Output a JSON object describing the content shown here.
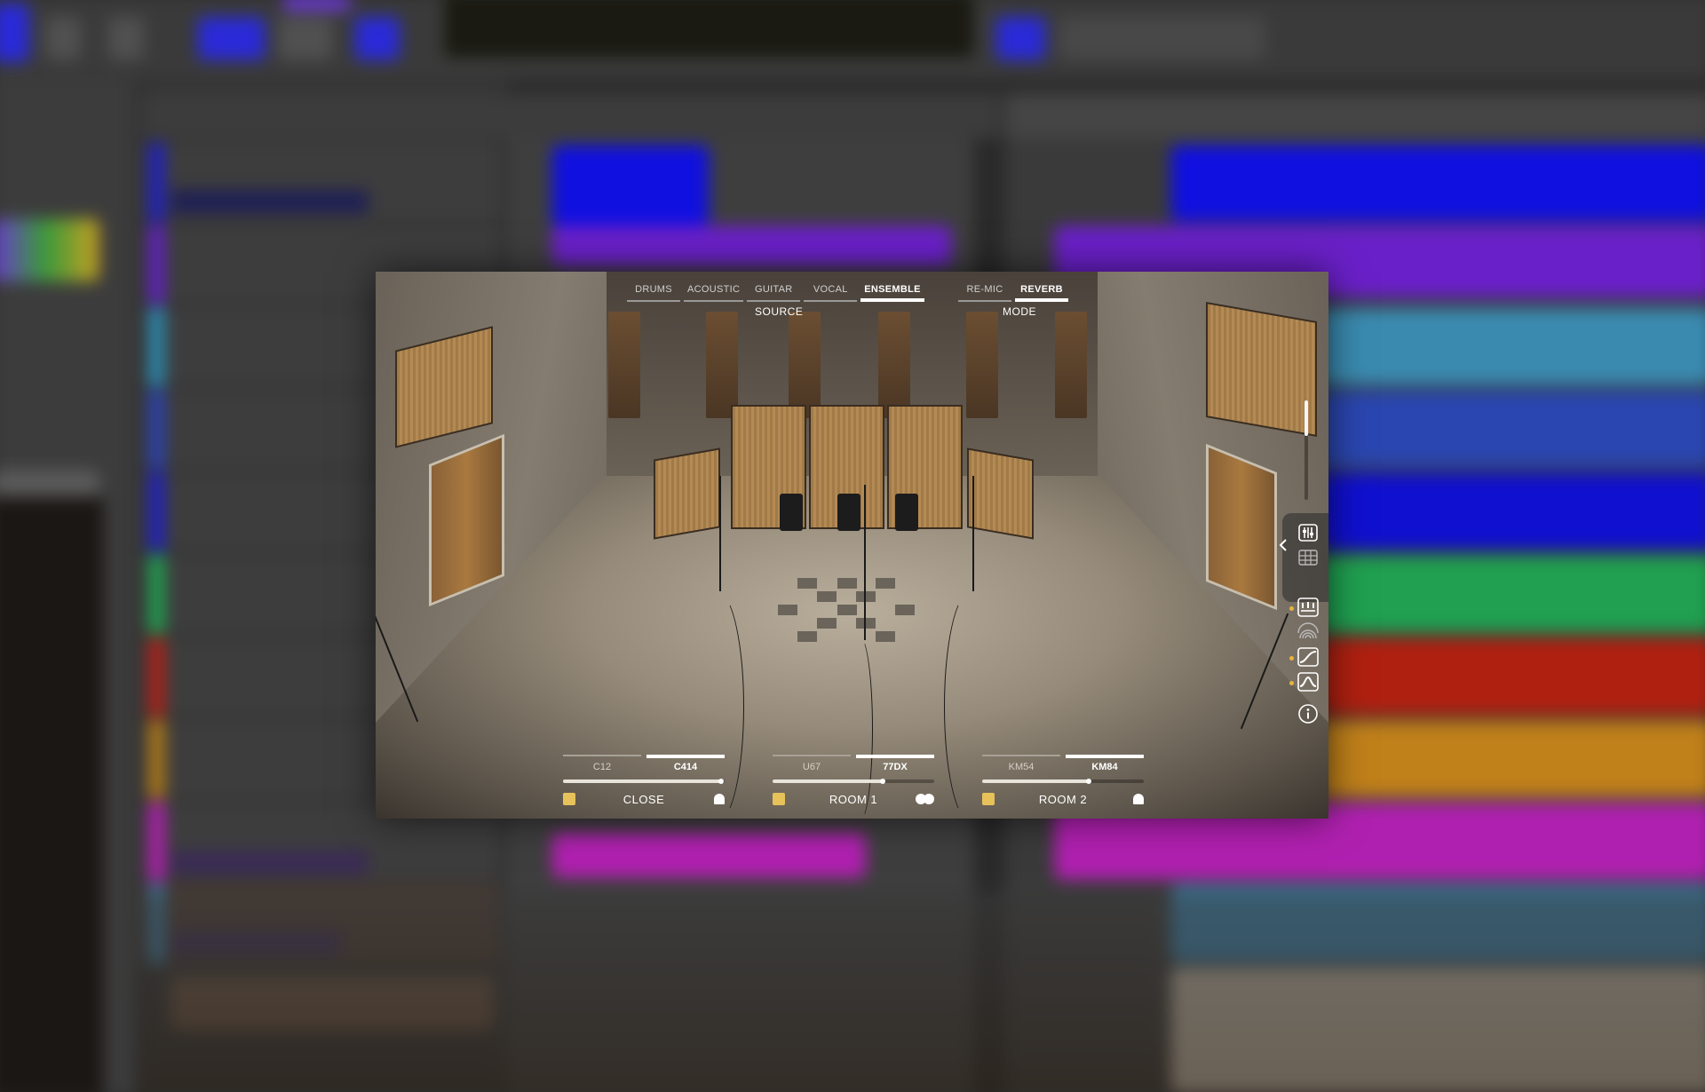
{
  "plugin": {
    "source": {
      "caption": "SOURCE",
      "tabs": [
        {
          "label": "DRUMS",
          "active": false
        },
        {
          "label": "ACOUSTIC",
          "active": false
        },
        {
          "label": "GUITAR",
          "active": false
        },
        {
          "label": "VOCAL",
          "active": false
        },
        {
          "label": "ENSEMBLE",
          "active": true
        }
      ]
    },
    "mode": {
      "caption": "MODE",
      "tabs": [
        {
          "label": "RE-MIC",
          "active": false
        },
        {
          "label": "REVERB",
          "active": true
        }
      ]
    },
    "mics": [
      {
        "name": "CLOSE",
        "options": [
          "C12",
          "C414"
        ],
        "selected": "C414",
        "level": 0.98,
        "enabled": true,
        "pattern": "half"
      },
      {
        "name": "ROOM 1",
        "options": [
          "U67",
          "77DX"
        ],
        "selected": "77DX",
        "level": 0.68,
        "enabled": true,
        "pattern": "double"
      },
      {
        "name": "ROOM 2",
        "options": [
          "KM54",
          "KM84"
        ],
        "selected": "KM84",
        "level": 0.66,
        "enabled": true,
        "pattern": "half"
      }
    ],
    "output_level": 0.35,
    "side_icons": [
      "chevron-left-icon",
      "mixer-icon",
      "keyboard-grid-icon",
      "room-icon",
      "mic-stand-icon",
      "eq-curve-icon",
      "filter-curve-icon",
      "info-icon"
    ],
    "colors": {
      "accent": "#e7c25a",
      "text": "#ffffff"
    }
  }
}
